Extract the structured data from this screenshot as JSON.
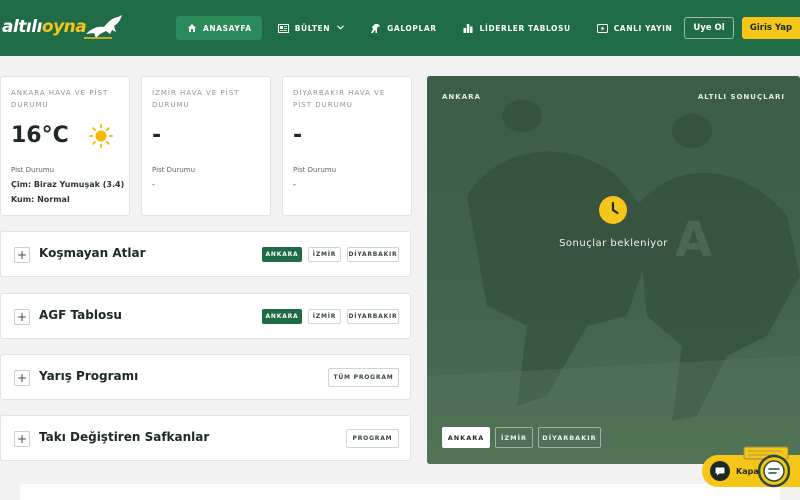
{
  "header": {
    "logo": {
      "text_main": "altılı",
      "text_accent": "oyna"
    },
    "nav": [
      {
        "label": "ANASAYFA",
        "icon": "home-icon",
        "active": true
      },
      {
        "label": "BÜLTEN",
        "icon": "newspaper-icon",
        "active": false,
        "dropdown": true
      },
      {
        "label": "GALOPLAR",
        "icon": "horse-icon",
        "active": false
      },
      {
        "label": "LİDERLER TABLOSU",
        "icon": "bar-chart-icon",
        "active": false
      },
      {
        "label": "CANLI YAYIN",
        "icon": "tv-icon",
        "active": false
      }
    ],
    "register_label": "Uye Ol",
    "login_label": "Giris Yap"
  },
  "weather": [
    {
      "title": "ANKARA HAVA VE PİST DURUMU",
      "value": "16°C",
      "icon": "sun-icon",
      "track_label": "Pist Durumu",
      "line1": "Çim: Biraz Yumuşak (3.4)",
      "line2": "Kum: Normal"
    },
    {
      "title": "İZMİR HAVA VE PİST DURUMU",
      "value": "-",
      "track_label": "Pist Durumu",
      "line1": "-"
    },
    {
      "title": "DİYARBAKIR HAVA VE PİST DURUMU",
      "value": "-",
      "track_label": "Pist Durumu",
      "line1": "-"
    }
  ],
  "sections": [
    {
      "title": "Koşmayan Atlar",
      "chips": [
        "ANKARA",
        "İZMİR",
        "DİYARBAKIR"
      ],
      "active": 0
    },
    {
      "title": "AGF Tablosu",
      "chips": [
        "ANKARA",
        "İZMİR",
        "DİYARBAKIR"
      ],
      "active": 0
    },
    {
      "title": "Yarış Programı",
      "chips": [
        "TÜM PROGRAM"
      ]
    },
    {
      "title": "Takı Değiştiren Safkanlar",
      "chips": [
        "PROGRAM"
      ]
    }
  ],
  "results": {
    "city": "ANKARA",
    "title": "ALTILI SONUÇLARI",
    "waiting": "Sonuçlar bekleniyor",
    "tabs": [
      "ANKARA",
      "İZMİR",
      "DİYARBAKIR"
    ],
    "active_tab": 0
  },
  "chat": {
    "label": "Kapat"
  },
  "colors": {
    "primary_green": "#1f6b45",
    "accent_yellow": "#f5c518"
  }
}
